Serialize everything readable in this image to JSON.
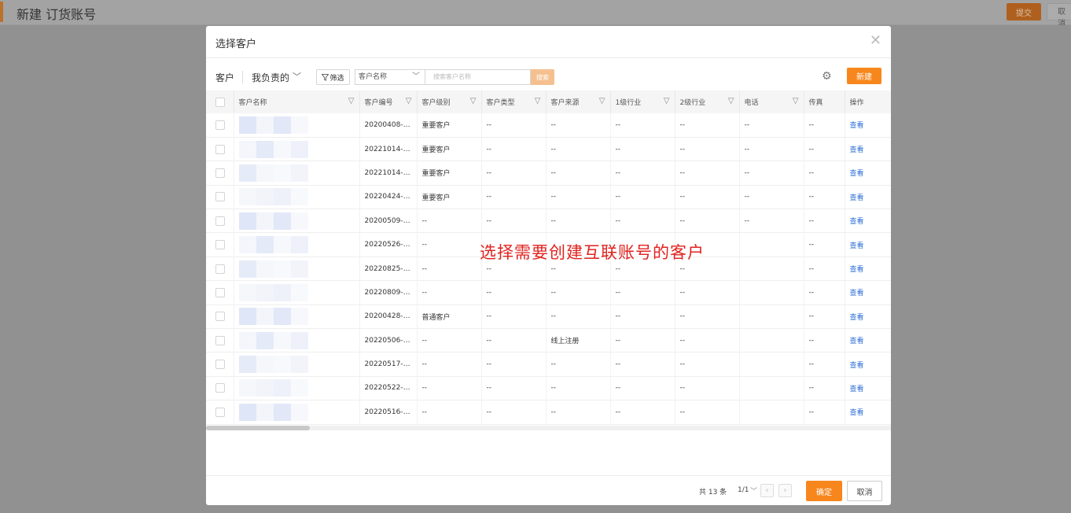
{
  "background": {
    "title": "新建 订货账号",
    "submit_label": "提交",
    "cancel_label": "取消"
  },
  "modal": {
    "title": "选择客户",
    "toolbar": {
      "customer_label": "客户",
      "mine_label": "我负责的",
      "filter_label": "筛选",
      "field_select": "客户名称",
      "search_placeholder": "搜索客户名称",
      "search_button": "搜索",
      "new_button": "新建"
    },
    "columns": [
      "客户名称",
      "客户编号",
      "客户级别",
      "客户类型",
      "客户来源",
      "1级行业",
      "2级行业",
      "电话",
      "传真",
      "操作"
    ],
    "rows": [
      {
        "code": "20200408-00...",
        "level": "重要客户",
        "type": "--",
        "source": "--",
        "ind1": "--",
        "ind2": "--",
        "phone": "--",
        "fax": "--",
        "action": "查看"
      },
      {
        "code": "20221014-00...",
        "level": "重要客户",
        "type": "--",
        "source": "--",
        "ind1": "--",
        "ind2": "--",
        "phone": "--",
        "fax": "--",
        "action": "查看"
      },
      {
        "code": "20221014-00...",
        "level": "重要客户",
        "type": "--",
        "source": "--",
        "ind1": "--",
        "ind2": "--",
        "phone": "--",
        "fax": "--",
        "action": "查看"
      },
      {
        "code": "20220424-00...",
        "level": "重要客户",
        "type": "--",
        "source": "--",
        "ind1": "--",
        "ind2": "--",
        "phone": "--",
        "fax": "--",
        "action": "查看"
      },
      {
        "code": "20200509-00...",
        "level": "--",
        "type": "--",
        "source": "--",
        "ind1": "--",
        "ind2": "--",
        "phone": "--",
        "fax": "--",
        "action": "查看"
      },
      {
        "code": "20220526-00...",
        "level": "--",
        "type": "",
        "source": "",
        "ind1": "",
        "ind2": "",
        "phone": "",
        "fax": "--",
        "action": "查看"
      },
      {
        "code": "20220825-00...",
        "level": "--",
        "type": "--",
        "source": "--",
        "ind1": "--",
        "ind2": "--",
        "phone": "",
        "fax": "--",
        "action": "查看"
      },
      {
        "code": "20220809-00...",
        "level": "--",
        "type": "--",
        "source": "--",
        "ind1": "--",
        "ind2": "--",
        "phone": "",
        "fax": "--",
        "action": "查看"
      },
      {
        "code": "20200428-00...",
        "level": "普通客户",
        "type": "--",
        "source": "--",
        "ind1": "--",
        "ind2": "--",
        "phone": "",
        "fax": "--",
        "action": "查看"
      },
      {
        "code": "20220506-00...",
        "level": "--",
        "type": "--",
        "source": "线上注册",
        "ind1": "--",
        "ind2": "--",
        "phone": "",
        "fax": "--",
        "action": "查看"
      },
      {
        "code": "20220517-00...",
        "level": "--",
        "type": "--",
        "source": "--",
        "ind1": "--",
        "ind2": "--",
        "phone": "",
        "fax": "--",
        "action": "查看"
      },
      {
        "code": "20220522-00...",
        "level": "--",
        "type": "--",
        "source": "--",
        "ind1": "--",
        "ind2": "--",
        "phone": "",
        "fax": "--",
        "action": "查看"
      },
      {
        "code": "20220516-00...",
        "level": "--",
        "type": "--",
        "source": "--",
        "ind1": "--",
        "ind2": "--",
        "phone": "",
        "fax": "--",
        "action": "查看"
      }
    ],
    "annotation": "选择需要创建互联账号的客户",
    "footer": {
      "total": "共 13 条",
      "page": "1/1",
      "ok_label": "确定",
      "cancel_label": "取消"
    }
  },
  "colors": {
    "accent": "#f7871d",
    "link": "#2b6dd6",
    "annotation": "#e0231f"
  }
}
